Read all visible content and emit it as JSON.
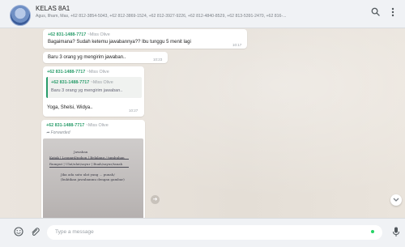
{
  "header": {
    "group_name": "KELAS 8A1",
    "members": "Agus, Ilham, Mas, +62 812-3854-5043, +62 812-3869-1524, +62 812-3927-9226, +62 812-4840-8529, +62 813-5391-2470, +62 816-..."
  },
  "messages": [
    {
      "sender": "+62 831-1488-7717",
      "alias": "~Miss Olive",
      "text": "Bagaimana? Sudah ketemu jawabannya?? Ibu tunggu 5 menit lagi",
      "time": "10:17"
    },
    {
      "text": "Baru 3 orang yg mengirim jawaban..",
      "time": "10:23"
    },
    {
      "sender": "+62 831-1488-7717",
      "alias": "~Miss Olive",
      "quote_sender": "+62 831-1488-7717",
      "quote_alias": "~Miss Olive",
      "quote_text": "Baru 3 orang yg mengirim jawaban..",
      "text": "Yoga, Shelsi, Widya..",
      "time": "10:27"
    },
    {
      "sender": "+62 831-1488-7717",
      "alias": "~Miss Olive",
      "forwarded": "Forwarded"
    }
  ],
  "photo": {
    "lines": [
      "Jawaban",
      "Katak | Leopard/pohon | Belalang / tumbuhan",
      "Rumput | Ulat/ulat/sayur | Buah/sayur/tanah",
      "Jika ada satu ulat yang ... punah/",
      "(buktikan jawabanmu dengan gambar)"
    ]
  },
  "footer": {
    "placeholder": "Type a message"
  },
  "icons": {
    "search": "search-icon",
    "menu": "more-vertical-icon",
    "emoji": "emoji-icon",
    "attach": "paperclip-icon",
    "mic": "microphone-icon",
    "share": "forward-share-icon",
    "scroll": "chevron-down-icon"
  },
  "colors": {
    "sender": "#2a9d6b",
    "header_bg": "#f0f2f5",
    "chat_bg": "#e9e3dc",
    "online_dot": "#25d366"
  }
}
